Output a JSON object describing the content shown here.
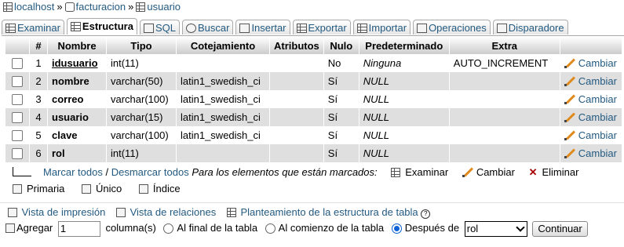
{
  "breadcrumb": {
    "server": "localhost",
    "database": "facturacion",
    "table": "usuario",
    "separator": "»"
  },
  "tabs": [
    {
      "label": "Examinar",
      "icon": "browse-icon",
      "active": false
    },
    {
      "label": "Estructura",
      "icon": "structure-icon",
      "active": true
    },
    {
      "label": "SQL",
      "icon": "sql-icon",
      "active": false
    },
    {
      "label": "Buscar",
      "icon": "search-icon",
      "active": false
    },
    {
      "label": "Insertar",
      "icon": "insert-icon",
      "active": false
    },
    {
      "label": "Exportar",
      "icon": "export-icon",
      "active": false
    },
    {
      "label": "Importar",
      "icon": "import-icon",
      "active": false
    },
    {
      "label": "Operaciones",
      "icon": "operations-icon",
      "active": false
    },
    {
      "label": "Disparadore",
      "icon": "triggers-icon",
      "active": false
    }
  ],
  "table": {
    "headers": [
      "#",
      "Nombre",
      "Tipo",
      "Cotejamiento",
      "Atributos",
      "Nulo",
      "Predeterminado",
      "Extra"
    ],
    "change_label": "Cambiar",
    "rows": [
      {
        "num": "1",
        "name": "idusuario",
        "type": "int(11)",
        "collation": "",
        "attributes": "",
        "null": "No",
        "default": "Ninguna",
        "extra": "AUTO_INCREMENT",
        "primary": true
      },
      {
        "num": "2",
        "name": "nombre",
        "type": "varchar(50)",
        "collation": "latin1_swedish_ci",
        "attributes": "",
        "null": "Sí",
        "default": "NULL",
        "extra": ""
      },
      {
        "num": "3",
        "name": "correo",
        "type": "varchar(100)",
        "collation": "latin1_swedish_ci",
        "attributes": "",
        "null": "Sí",
        "default": "NULL",
        "extra": ""
      },
      {
        "num": "4",
        "name": "usuario",
        "type": "varchar(15)",
        "collation": "latin1_swedish_ci",
        "attributes": "",
        "null": "Sí",
        "default": "NULL",
        "extra": ""
      },
      {
        "num": "5",
        "name": "clave",
        "type": "varchar(100)",
        "collation": "latin1_swedish_ci",
        "attributes": "",
        "null": "Sí",
        "default": "NULL",
        "extra": ""
      },
      {
        "num": "6",
        "name": "rol",
        "type": "int(11)",
        "collation": "",
        "attributes": "",
        "null": "Sí",
        "default": "NULL",
        "extra": ""
      }
    ]
  },
  "bulk": {
    "check_all": "Marcar todos",
    "slash": " / ",
    "uncheck_all": "Desmarcar todos",
    "with_selected": "Para los elementos que están marcados:",
    "browse": "Examinar",
    "change": "Cambiar",
    "drop": "Eliminar"
  },
  "index_actions": {
    "primary": "Primaria",
    "unique": "Único",
    "index": "Índice"
  },
  "views": {
    "print": "Vista de impresión",
    "relations": "Vista de relaciones",
    "propose": "Planteamiento de la estructura de tabla"
  },
  "add_columns": {
    "label": "Agregar",
    "count_value": "1",
    "columns_label": "columna(s)",
    "end_label": "Al final de la tabla",
    "start_label": "Al comienzo de la tabla",
    "after_label": "Después de",
    "after_value": "rol",
    "submit": "Continuar"
  }
}
